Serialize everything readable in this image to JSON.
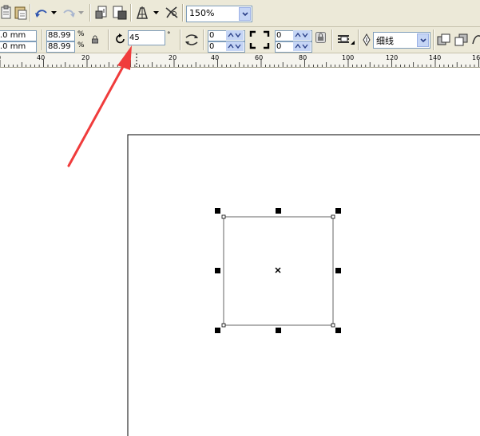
{
  "standard_toolbar": {
    "zoom_value": "150%",
    "icons": [
      "paste-icon",
      "paste-special-icon",
      "undo-icon",
      "redo-icon",
      "import-icon",
      "export-icon",
      "application-launcher-icon",
      "welcome-screen-icon"
    ]
  },
  "property_bar": {
    "pos_x": ".0 mm",
    "pos_y": ".0 mm",
    "scale_x": "88.99",
    "scale_y": "88.99",
    "percent_sign": "%",
    "rotation_value": "45",
    "degree_sign": "°",
    "corner_left_top": "0",
    "corner_left_bottom": "0",
    "corner_right_top": "0",
    "corner_right_bottom": "0",
    "outline_width": "细线"
  },
  "ruler": {
    "ticks": [
      {
        "value": "0"
      },
      {
        "value": "40"
      },
      {
        "value": "20"
      },
      {
        "value": "0"
      },
      {
        "value": "20"
      },
      {
        "value": "40"
      },
      {
        "value": "60"
      },
      {
        "value": "80"
      },
      {
        "value": "100"
      },
      {
        "value": "120"
      },
      {
        "value": "140"
      },
      {
        "value": "160"
      }
    ]
  },
  "canvas": {
    "selected_object": "rectangle",
    "rotation_degrees": 45
  },
  "annotation": {
    "arrow_color": "#f03c3c",
    "points_to": "rotation-angle-input"
  }
}
